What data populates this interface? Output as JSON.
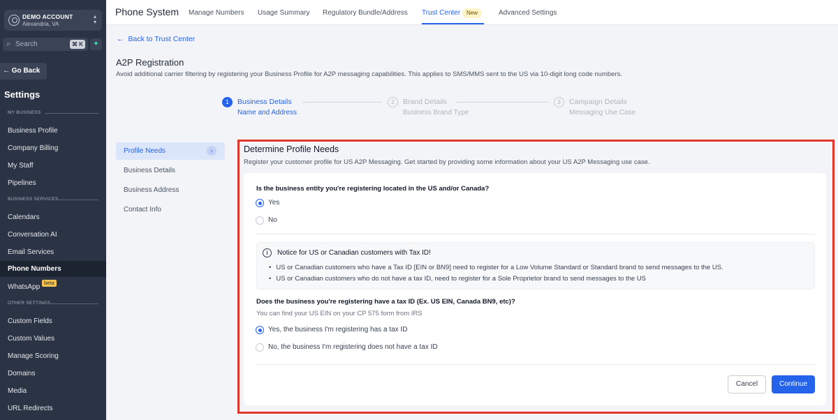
{
  "sidebar": {
    "account": {
      "name": "DEMO ACCOUNT",
      "location": "Alexandria, VA"
    },
    "search": {
      "placeholder": "Search",
      "shortcut": "⌘ K"
    },
    "go_back": "Go Back",
    "title": "Settings",
    "sections": {
      "my_business": "MY BUSINESS",
      "business_services": "BUSINESS SERVICES",
      "other_settings": "OTHER SETTINGS"
    },
    "items": [
      "Business Profile",
      "Company Billing",
      "My Staff",
      "Pipelines",
      "Calendars",
      "Conversation AI",
      "Email Services",
      "Phone Numbers",
      "WhatsApp",
      "Custom Fields",
      "Custom Values",
      "Manage Scoring",
      "Domains",
      "Media",
      "URL Redirects"
    ],
    "beta_label": "beta"
  },
  "topnav": {
    "title": "Phone System",
    "tabs": [
      "Manage Numbers",
      "Usage Summary",
      "Regulatory Bundle/Address",
      "Trust Center",
      "Advanced Settings"
    ],
    "new_badge": "New"
  },
  "page": {
    "back_link": "Back to Trust Center",
    "title": "A2P Registration",
    "description": "Avoid additional carrier filtering by registering your Business Profile for A2P messaging capabilities. This applies to SMS/MMS sent to the US via 10-digit long code numbers."
  },
  "steps": [
    {
      "num": "1",
      "title": "Business Details",
      "subtitle": "Name and Address"
    },
    {
      "num": "2",
      "title": "Brand Details",
      "subtitle": "Business Brand Type"
    },
    {
      "num": "3",
      "title": "Campaign Details",
      "subtitle": "Messaging Use Case"
    }
  ],
  "subnav": [
    "Profile Needs",
    "Business Details",
    "Business Address",
    "Contact Info"
  ],
  "form": {
    "title": "Determine Profile Needs",
    "description": "Register your customer profile for US A2P Messaging. Get started by providing some information about your US A2P Messaging use case.",
    "q1": {
      "label": "Is the business entity you're registering located in the US and/or Canada?",
      "options": [
        "Yes",
        "No"
      ],
      "selected": "Yes"
    },
    "notice": {
      "title": "Notice for US or Canadian customers with Tax ID!",
      "bullets": [
        "US or Canadian customers who have a Tax ID [EIN or BN9] need to register for a Low Volume Standard or Standard brand to send messages to the US.",
        "US or Canadian customers who do not have a tax ID, need to register for a Sole Proprietor brand to send messages to the US"
      ]
    },
    "q2": {
      "label": "Does the business you're registering have a tax ID (Ex. US EIN, Canada BN9, etc)?",
      "hint": "You can find your US EIN on your CP 575 form from IRS",
      "options": [
        "Yes, the business I'm registering has a tax ID",
        "No, the business I'm registering does not have a tax ID"
      ],
      "selected": "Yes, the business I'm registering has a tax ID"
    },
    "cancel": "Cancel",
    "continue": "Continue"
  },
  "colors": {
    "accent": "#2563eb",
    "sidebar_bg": "#2b3445",
    "highlight_frame": "#e0362c"
  }
}
